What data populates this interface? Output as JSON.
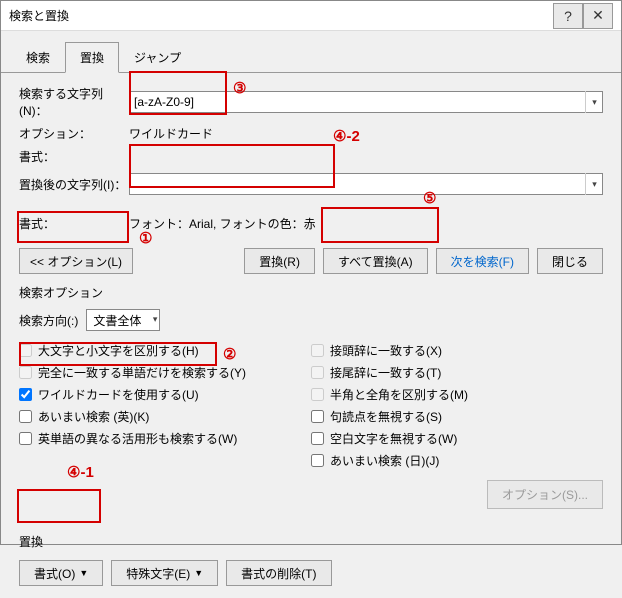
{
  "title": "検索と置換",
  "tabs": {
    "search": "検索",
    "replace": "置換",
    "jump": "ジャンプ"
  },
  "find": {
    "label": "検索する文字列(N)：",
    "value": "[a-zA-Z0-9]",
    "option_label": "オプション：",
    "option_value": "ワイルドカード",
    "format_label": "書式：",
    "format_value": ""
  },
  "repl": {
    "label": "置換後の文字列(I)：",
    "value": "",
    "format_label": "書式：",
    "format_value": "フォント：Arial, フォントの色：赤"
  },
  "buttons": {
    "options": "<< オプション(L)",
    "replace": "置換(R)",
    "replaceAll": "すべて置換(A)",
    "findNext": "次を検索(F)",
    "close": "閉じる"
  },
  "searchOptions": {
    "title": "検索オプション",
    "dirLabel": "検索方向(:)",
    "dirValue": "文書全体",
    "left": [
      {
        "id": "case",
        "label": "大文字と小文字を区別する(H)",
        "checked": false,
        "disabled": true
      },
      {
        "id": "whole",
        "label": "完全に一致する単語だけを検索する(Y)",
        "checked": false,
        "disabled": true
      },
      {
        "id": "wildcard",
        "label": "ワイルドカードを使用する(U)",
        "checked": true,
        "disabled": false
      },
      {
        "id": "fuzzy",
        "label": "あいまい検索 (英)(K)",
        "checked": false,
        "disabled": false
      },
      {
        "id": "forms",
        "label": "英単語の異なる活用形も検索する(W)",
        "checked": false,
        "disabled": false
      }
    ],
    "right": [
      {
        "id": "prefix",
        "label": "接頭辞に一致する(X)",
        "checked": false,
        "disabled": true
      },
      {
        "id": "suffix",
        "label": "接尾辞に一致する(T)",
        "checked": false,
        "disabled": true
      },
      {
        "id": "width",
        "label": "半角と全角を区別する(M)",
        "checked": false,
        "disabled": true
      },
      {
        "id": "punct",
        "label": "句読点を無視する(S)",
        "checked": false,
        "disabled": false
      },
      {
        "id": "space",
        "label": "空白文字を無視する(W)",
        "checked": false,
        "disabled": false
      },
      {
        "id": "fuzzyJ",
        "label": "あいまい検索 (日)(J)",
        "checked": false,
        "disabled": false
      }
    ],
    "optionsBtn": "オプション(S)..."
  },
  "replaceSection": {
    "title": "置換",
    "format": "書式(O)",
    "special": "特殊文字(E)",
    "clear": "書式の削除(T)"
  },
  "annotations": {
    "a1": "①",
    "a2": "②",
    "a3": "③",
    "a41": "④-1",
    "a42": "④-2",
    "a5": "⑤"
  }
}
